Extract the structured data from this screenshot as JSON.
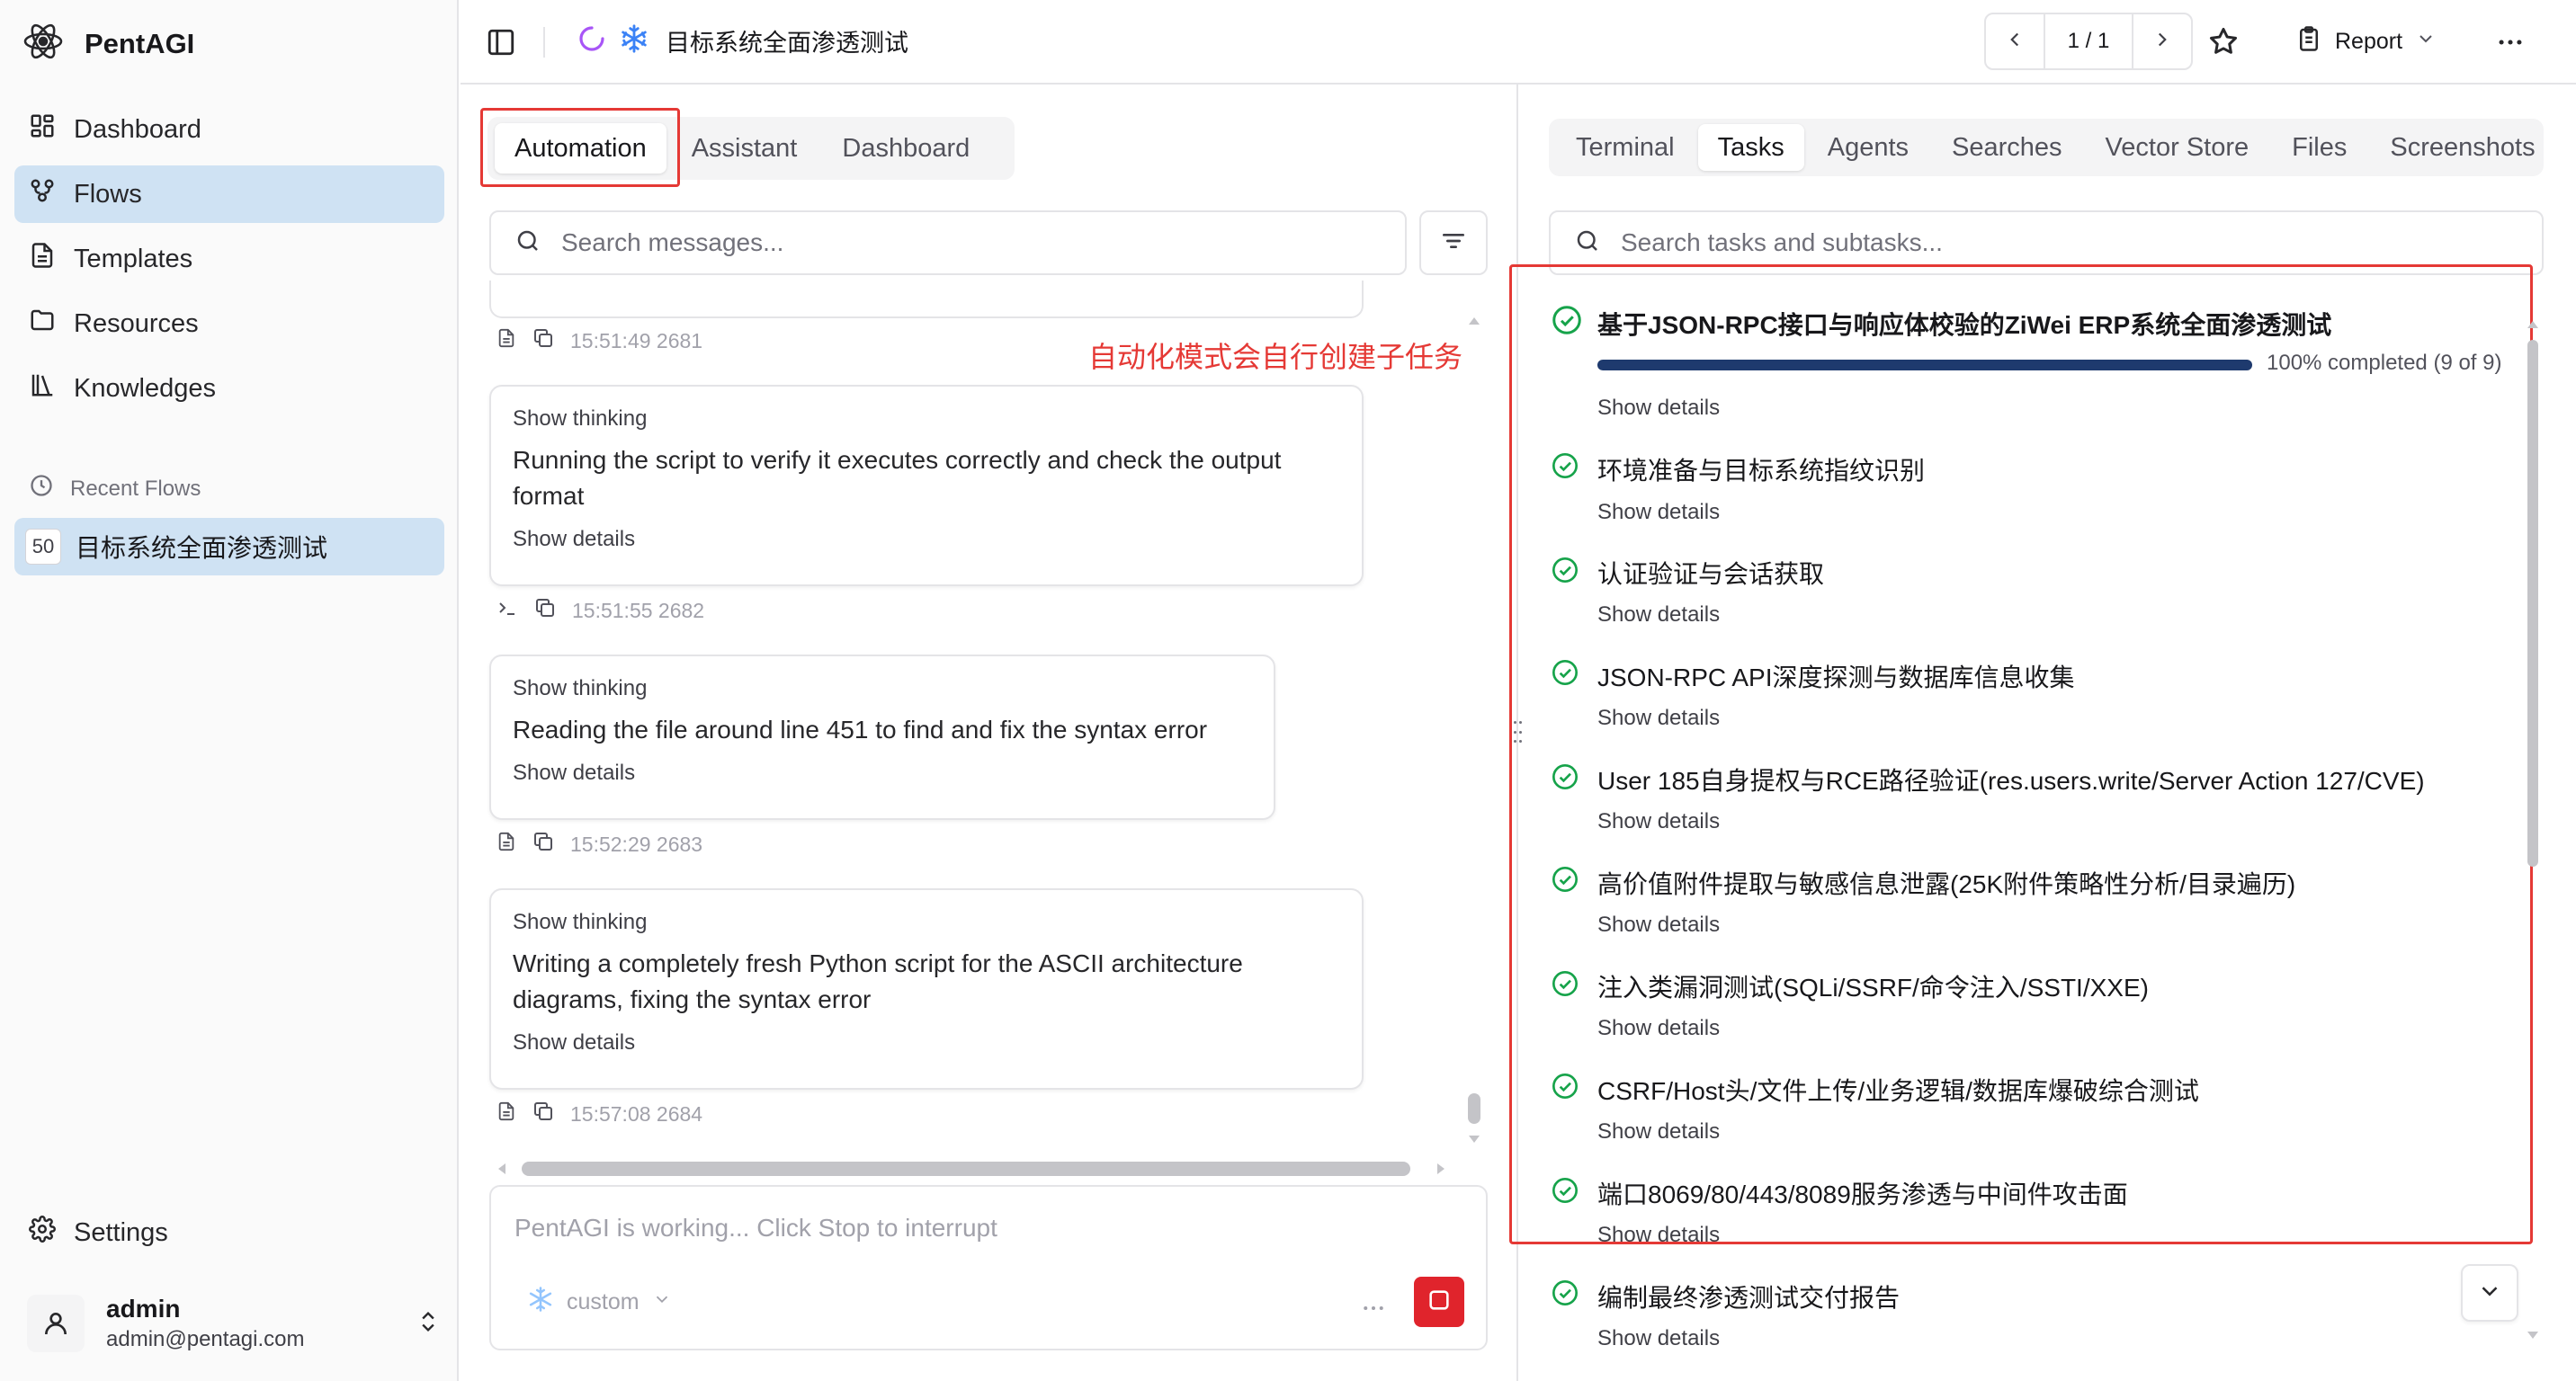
{
  "colors": {
    "accent_active_bg": "#cfe2f3",
    "annotation_red": "#e53935",
    "success_green": "#16a34a",
    "progress_fill": "#1e3a6e",
    "stop_red": "#e0242c"
  },
  "brand": {
    "name": "PentAGI",
    "icon": "atom-logo-icon"
  },
  "sidebar": {
    "nav": [
      {
        "label": "Dashboard",
        "icon": "dashboard-icon"
      },
      {
        "label": "Flows",
        "icon": "flows-icon",
        "active": true
      },
      {
        "label": "Templates",
        "icon": "templates-icon"
      },
      {
        "label": "Resources",
        "icon": "folder-icon"
      },
      {
        "label": "Knowledges",
        "icon": "library-icon"
      }
    ],
    "recent_label": "Recent Flows",
    "recent": [
      {
        "id": "50",
        "title": "目标系统全面渗透测试"
      }
    ],
    "settings_label": "Settings",
    "user": {
      "name": "admin",
      "email": "admin@pentagi.com"
    }
  },
  "header": {
    "flow_title": "目标系统全面渗透测试",
    "pager": "1 / 1",
    "report_label": "Report"
  },
  "chat": {
    "tabs": [
      "Automation",
      "Assistant",
      "Dashboard"
    ],
    "active_tab": "Automation",
    "search_placeholder": "Search messages...",
    "annotation": "自动化模式会自行创建子任务",
    "messages": [
      {
        "meta": "15:51:49 2681"
      },
      {
        "thinking": "Show thinking",
        "text": "Running the script to verify it executes correctly and check the output format",
        "details": "Show details",
        "meta": "15:51:55 2682"
      },
      {
        "thinking": "Show thinking",
        "text": "Reading the file around line 451 to find and fix the syntax error",
        "details": "Show details",
        "meta": "15:52:29 2683"
      },
      {
        "thinking": "Show thinking",
        "text": "Writing a completely fresh Python script for the ASCII architecture diagrams, fixing the syntax error",
        "details": "Show details",
        "meta": "15:57:08 2684"
      }
    ],
    "composer_placeholder": "PentAGI is working... Click Stop to interrupt",
    "model": "custom"
  },
  "tasks_panel": {
    "tabs": [
      "Terminal",
      "Tasks",
      "Agents",
      "Searches",
      "Vector Store",
      "Files",
      "Screenshots"
    ],
    "active_tab": "Tasks",
    "search_placeholder": "Search tasks and subtasks...",
    "main_task": {
      "title": "基于JSON-RPC接口与响应体校验的ZiWei ERP系统全面渗透测试",
      "progress": 1.0,
      "progress_label": "100% completed (9 of 9)",
      "details": "Show details"
    },
    "subtasks": [
      {
        "title": "环境准备与目标系统指纹识别",
        "details": "Show details"
      },
      {
        "title": "认证验证与会话获取",
        "details": "Show details"
      },
      {
        "title": "JSON-RPC API深度探测与数据库信息收集",
        "details": "Show details"
      },
      {
        "title": "User 185自身提权与RCE路径验证(res.users.write/Server Action 127/CVE)",
        "details": "Show details"
      },
      {
        "title": "高价值附件提取与敏感信息泄露(25K附件策略性分析/目录遍历)",
        "details": "Show details"
      },
      {
        "title": "注入类漏洞测试(SQLi/SSRF/命令注入/SSTI/XXE)",
        "details": "Show details"
      },
      {
        "title": "CSRF/Host头/文件上传/业务逻辑/数据库爆破综合测试",
        "details": "Show details"
      },
      {
        "title": "端口8069/80/443/8089服务渗透与中间件攻击面",
        "details": "Show details"
      },
      {
        "title": "编制最终渗透测试交付报告",
        "details": "Show details"
      }
    ]
  }
}
